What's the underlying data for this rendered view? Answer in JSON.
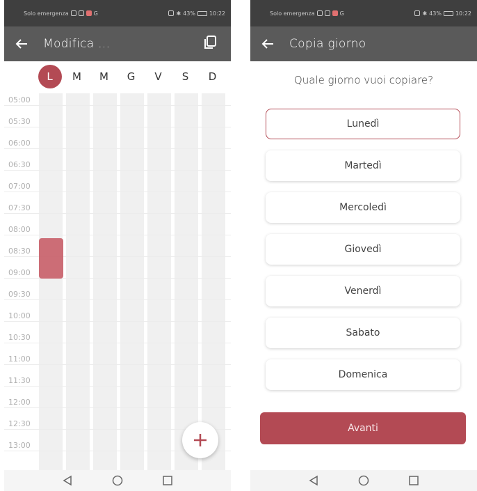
{
  "status": {
    "left_text": "Solo emergenza",
    "battery": "43%",
    "time": "10:22",
    "network_icons": [
      "sim-icon",
      "wifi-icon",
      "app-icon",
      "g-icon"
    ]
  },
  "left_screen": {
    "title": "Modifica ...",
    "days": [
      "L",
      "M",
      "M",
      "G",
      "V",
      "S",
      "D"
    ],
    "selected_day_index": 0,
    "times": [
      "05:00",
      "05:30",
      "06:00",
      "06:30",
      "07:00",
      "07:30",
      "08:00",
      "08:30",
      "09:00",
      "09:30",
      "10:00",
      "10:30",
      "11:00",
      "11:30",
      "12:00",
      "12:30",
      "13:00"
    ],
    "event": {
      "day": "L",
      "start": "08:00",
      "end": "09:00"
    },
    "fab_icon": "plus-icon",
    "accent_color": "#b34a54"
  },
  "right_screen": {
    "title": "Copia giorno",
    "question": "Quale giorno vuoi copiare?",
    "options": [
      "Lunedì",
      "Martedì",
      "Mercoledì",
      "Giovedì",
      "Venerdì",
      "Sabato",
      "Domenica"
    ],
    "selected_option": "Lunedì",
    "next_label": "Avanti"
  }
}
